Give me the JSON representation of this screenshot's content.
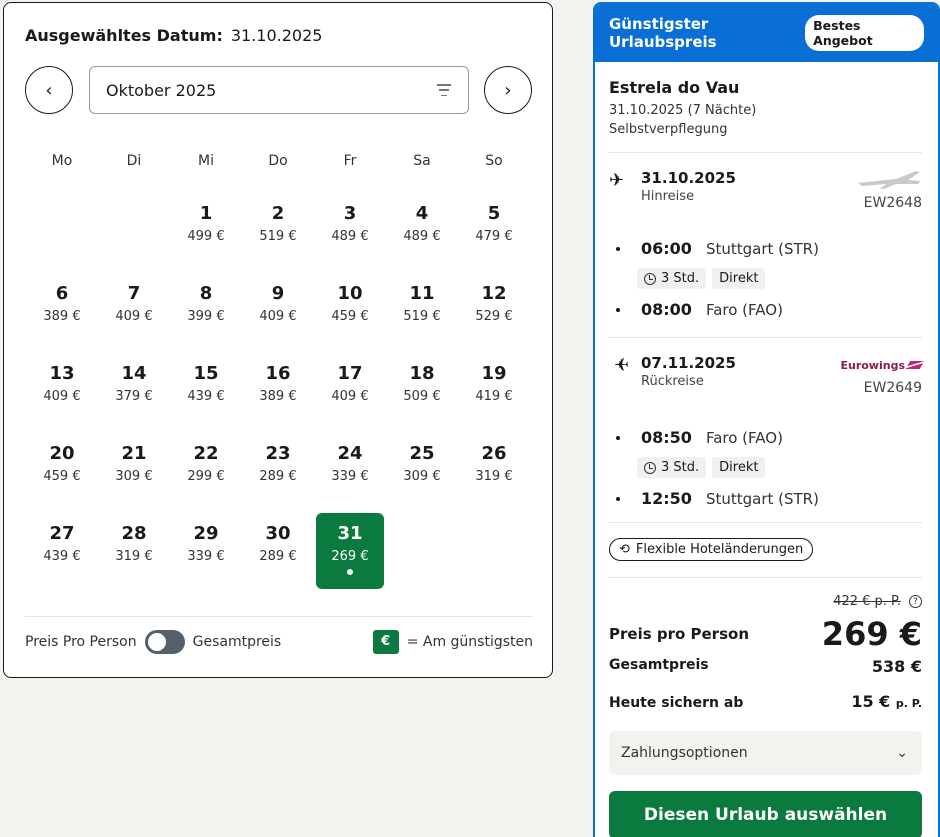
{
  "calendar": {
    "selected_label": "Ausgewähltes Datum:",
    "selected_date": "31.10.2025",
    "prev_icon": "‹",
    "next_icon": "›",
    "month": "Oktober 2025",
    "weekdays": [
      "Mo",
      "Di",
      "Mi",
      "Do",
      "Fr",
      "Sa",
      "So"
    ],
    "days": [
      {
        "num": "",
        "price": ""
      },
      {
        "num": "",
        "price": ""
      },
      {
        "num": "1",
        "price": "499 €"
      },
      {
        "num": "2",
        "price": "519 €"
      },
      {
        "num": "3",
        "price": "489 €"
      },
      {
        "num": "4",
        "price": "489 €"
      },
      {
        "num": "5",
        "price": "479 €"
      },
      {
        "num": "6",
        "price": "389 €"
      },
      {
        "num": "7",
        "price": "409 €"
      },
      {
        "num": "8",
        "price": "399 €"
      },
      {
        "num": "9",
        "price": "409 €"
      },
      {
        "num": "10",
        "price": "459 €"
      },
      {
        "num": "11",
        "price": "519 €"
      },
      {
        "num": "12",
        "price": "529 €"
      },
      {
        "num": "13",
        "price": "409 €"
      },
      {
        "num": "14",
        "price": "379 €"
      },
      {
        "num": "15",
        "price": "439 €"
      },
      {
        "num": "16",
        "price": "389 €"
      },
      {
        "num": "17",
        "price": "409 €"
      },
      {
        "num": "18",
        "price": "509 €"
      },
      {
        "num": "19",
        "price": "419 €"
      },
      {
        "num": "20",
        "price": "459 €"
      },
      {
        "num": "21",
        "price": "309 €"
      },
      {
        "num": "22",
        "price": "299 €"
      },
      {
        "num": "23",
        "price": "289 €"
      },
      {
        "num": "24",
        "price": "339 €"
      },
      {
        "num": "25",
        "price": "309 €"
      },
      {
        "num": "26",
        "price": "319 €"
      },
      {
        "num": "27",
        "price": "439 €"
      },
      {
        "num": "28",
        "price": "319 €"
      },
      {
        "num": "29",
        "price": "339 €"
      },
      {
        "num": "30",
        "price": "289 €"
      },
      {
        "num": "31",
        "price": "269 €",
        "selected": true
      }
    ],
    "footer": {
      "per_person": "Preis Pro Person",
      "total": "Gesamtpreis",
      "legend_symbol": "€",
      "legend_text": "= Am günstigsten"
    }
  },
  "offer": {
    "header_title": "Günstigster Urlaubspreis",
    "badge": "Bestes Angebot",
    "hotel_name": "Estrela do Vau",
    "dates": "31.10.2025 (7 Nächte)",
    "board": "Selbstverpflegung",
    "outbound": {
      "date": "31.10.2025",
      "type": "Hinreise",
      "flight_no": "EW2648",
      "dep_time": "06:00",
      "dep_airport": "Stuttgart (STR)",
      "duration": "3 Std.",
      "stops": "Direkt",
      "arr_time": "08:00",
      "arr_airport": "Faro (FAO)"
    },
    "return": {
      "date": "07.11.2025",
      "type": "Rückreise",
      "airline": "Eurowings",
      "flight_no": "EW2649",
      "dep_time": "08:50",
      "dep_airport": "Faro (FAO)",
      "duration": "3 Std.",
      "stops": "Direkt",
      "arr_time": "12:50",
      "arr_airport": "Stuttgart (STR)"
    },
    "flex_label": "Flexible Hoteländerungen",
    "old_price": "422 € p. P.",
    "per_person_label": "Preis pro Person",
    "per_person_price": "269 €",
    "total_label": "Gesamtpreis",
    "total_price": "538 €",
    "deposit_label": "Heute sichern ab",
    "deposit_price": "15 €",
    "deposit_unit": "p. P.",
    "payment_label": "Zahlungsoptionen",
    "cta": "Diesen Urlaub auswählen"
  },
  "colors": {
    "accent_blue": "#0a6fd4",
    "green": "#0b7a3e"
  }
}
